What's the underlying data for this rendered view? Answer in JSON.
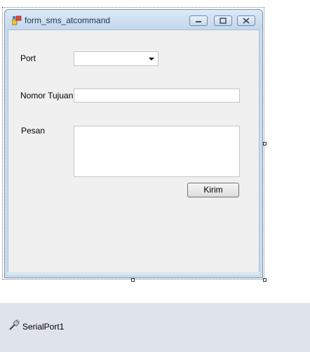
{
  "window": {
    "title": "form_sms_atcommand"
  },
  "form": {
    "port_label": "Port",
    "port_value": "",
    "nomor_label": "Nomor Tujuan",
    "nomor_value": "",
    "pesan_label": "Pesan",
    "pesan_value": "",
    "send_label": "Kirim"
  },
  "tray": {
    "component_label": "SerialPort1"
  },
  "colors": {
    "client_bg": "#f0f0f0",
    "titlebar": "#c9dcef",
    "tray_bg": "#dfe3ea"
  }
}
